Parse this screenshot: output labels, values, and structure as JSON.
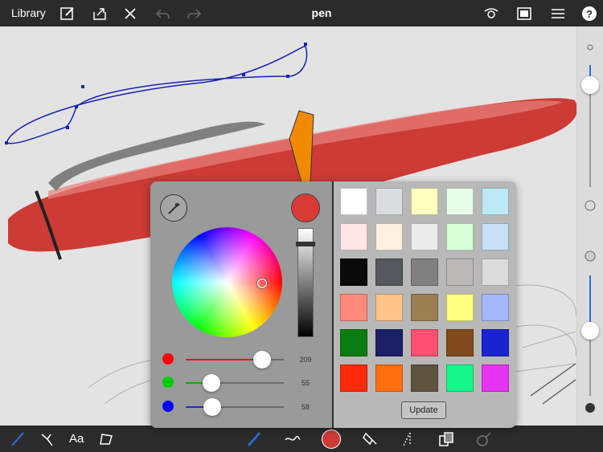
{
  "topbar": {
    "library_label": "Library",
    "title": "pen"
  },
  "icons": {
    "top_left": [
      "edit-icon",
      "share-icon",
      "close-icon",
      "undo-icon",
      "redo-icon"
    ],
    "top_right": [
      "visibility-icon",
      "canvas-icon",
      "layers-icon",
      "help-icon"
    ],
    "bottom": [
      "pencil-icon",
      "transform-icon",
      "text-tool-icon",
      "shape-icon",
      "brush-icon",
      "stroke-icon",
      "color-icon",
      "fill-icon",
      "guide-icon",
      "copy-icon",
      "symmetry-icon"
    ]
  },
  "bottombar": {
    "text_tool_label": "Aa"
  },
  "color_picker": {
    "current_color": "#d93a35",
    "sliders": [
      {
        "name": "red",
        "value": "209",
        "fraction": 0.78,
        "color": "#ff0000"
      },
      {
        "name": "green",
        "value": "55",
        "fraction": 0.26,
        "color": "#00cc00"
      },
      {
        "name": "blue",
        "value": "58",
        "fraction": 0.27,
        "color": "#0000ff"
      }
    ],
    "swatches": [
      [
        "#ffffff",
        "#d9dde0",
        "#ffffbf",
        "#e6ffe8",
        "#bfe8f7"
      ],
      [
        "#ffe6e6",
        "#fff1df",
        "#ececec",
        "#d8ffd8",
        "#c8e0f5"
      ],
      [
        "#0a0a0a",
        "#55595d",
        "#808080",
        "#bdb9b8",
        "#dcdcdc"
      ],
      [
        "#ff8a78",
        "#ffc48a",
        "#9b7e52",
        "#ffff80",
        "#a6b8ff"
      ],
      [
        "#0a7d10",
        "#1a1f66",
        "#ff4f72",
        "#804a1c",
        "#1a24d1"
      ],
      [
        "#ff2a0a",
        "#ff6f0f",
        "#5f5340",
        "#18f78e",
        "#e533f2"
      ]
    ],
    "update_label": "Update"
  }
}
